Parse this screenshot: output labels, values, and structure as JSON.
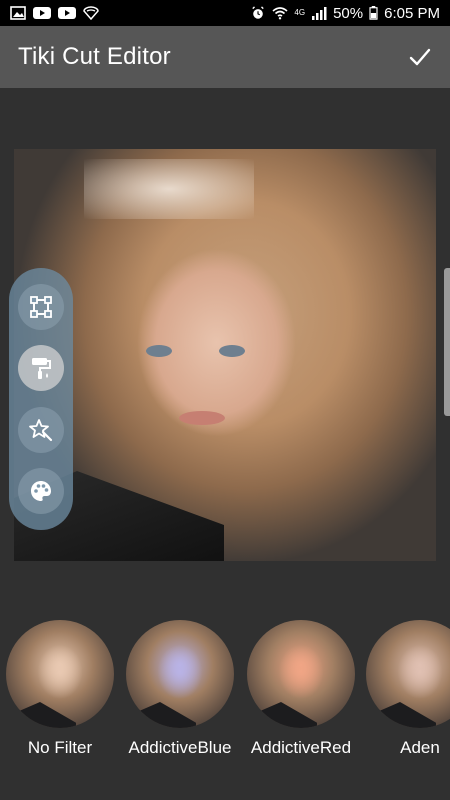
{
  "status_bar": {
    "battery": "50%",
    "time": "6:05 PM",
    "network": "4G",
    "left_icons": [
      "image-icon",
      "youtube-icon",
      "youtube-icon",
      "shield-icon"
    ],
    "right_icons": [
      "alarm-icon",
      "wifi-icon",
      "signal-icon",
      "battery-icon"
    ]
  },
  "app_bar": {
    "title": "Tiki Cut Editor",
    "action_icon": "check-icon"
  },
  "tools": [
    {
      "name": "crop-tool",
      "icon": "crop-icon",
      "active": false
    },
    {
      "name": "paint-tool",
      "icon": "paint-roller-icon",
      "active": true
    },
    {
      "name": "magic-tool",
      "icon": "magic-wand-icon",
      "active": false
    },
    {
      "name": "palette-tool",
      "icon": "palette-icon",
      "active": false
    }
  ],
  "filters": [
    {
      "label": "No Filter",
      "tint": "#e9c9b2"
    },
    {
      "label": "AddictiveBlue",
      "tint": "#b9b3e6"
    },
    {
      "label": "AddictiveRed",
      "tint": "#f0a585"
    },
    {
      "label": "Aden",
      "tint": "#e0c0b2"
    }
  ],
  "colors": {
    "background": "#303030",
    "app_bar": "#565656",
    "tool_panel": "#6c8aa0"
  }
}
